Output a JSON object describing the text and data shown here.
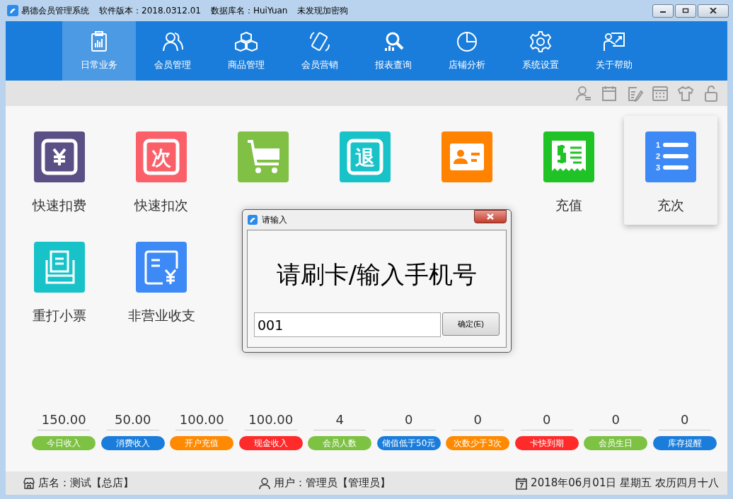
{
  "window": {
    "title": "易德会员管理系统",
    "info": [
      "软件版本：2018.0312.01",
      "数据库名：HuiYuan",
      "未发现加密狗"
    ]
  },
  "nav": [
    {
      "label": "日常业务",
      "selected": true
    },
    {
      "label": "会员管理",
      "selected": false
    },
    {
      "label": "商品管理",
      "selected": false
    },
    {
      "label": "会员营销",
      "selected": false
    },
    {
      "label": "报表查询",
      "selected": false
    },
    {
      "label": "店铺分析",
      "selected": false
    },
    {
      "label": "系统设置",
      "selected": false
    },
    {
      "label": "关于帮助",
      "selected": false
    }
  ],
  "tiles": [
    [
      {
        "label": "快速扣费",
        "kind": "yen",
        "color": "#5a5085",
        "selected": false
      },
      {
        "label": "快速扣次",
        "kind": "glyph",
        "glyph": "次",
        "color": "#fb6069",
        "selected": false
      },
      {
        "kind": "cart",
        "color": "#7fc045",
        "selected": false
      },
      {
        "kind": "glyph",
        "glyph": "退",
        "color": "#17c2c8",
        "selected": false
      },
      {
        "kind": "card",
        "color": "#ff8200",
        "selected": false
      },
      {
        "label": "充值",
        "kind": "receipt",
        "color": "#20c325",
        "selected": false
      },
      {
        "label": "充次",
        "kind": "list",
        "digits": [
          "1",
          "2",
          "3"
        ],
        "color": "#3d8af7",
        "selected": true
      }
    ],
    [
      {
        "label": "重打小票",
        "kind": "printer",
        "color": "#17c2c8",
        "selected": false
      },
      {
        "label": "非营业收支",
        "kind": "bill",
        "color": "#3d8af7",
        "selected": false
      }
    ]
  ],
  "stats": [
    {
      "value": "150.00",
      "label": "今日收入",
      "color": "#7dc243"
    },
    {
      "value": "50.00",
      "label": "消费收入",
      "color": "#1a7ddb"
    },
    {
      "value": "100.00",
      "label": "开户充值",
      "color": "#ff8a00"
    },
    {
      "value": "100.00",
      "label": "现金收入",
      "color": "#ff2a2a"
    },
    {
      "value": "4",
      "label": "会员人数",
      "color": "#7dc243"
    },
    {
      "value": "0",
      "label": "储值低于50元",
      "color": "#1a7ddb"
    },
    {
      "value": "0",
      "label": "次数少于3次",
      "color": "#ff8a00"
    },
    {
      "value": "0",
      "label": "卡快到期",
      "color": "#ff2a2a"
    },
    {
      "value": "0",
      "label": "会员生日",
      "color": "#7dc243"
    },
    {
      "value": "0",
      "label": "库存提醒",
      "color": "#1a7ddb"
    }
  ],
  "status_bar": {
    "shop": "店名：测试【总店】",
    "user": "用户：管理员【管理员】",
    "date": "2018年06月01日 星期五 农历四月十八"
  },
  "dialog": {
    "title": "请输入",
    "prompt": "请刷卡/输入手机号",
    "value": "001",
    "button": "确定(E)"
  }
}
